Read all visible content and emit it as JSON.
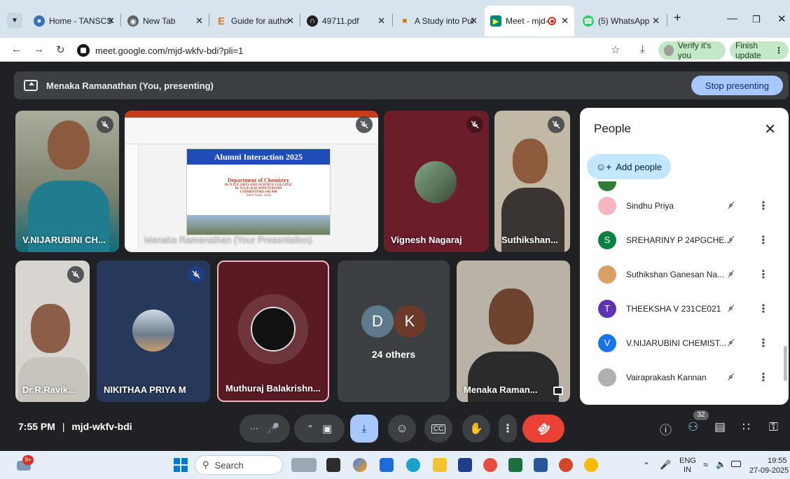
{
  "browser": {
    "tabs": [
      {
        "label": "Home - TANSCS",
        "icon": "tanscs-icon"
      },
      {
        "label": "New Tab",
        "icon": "chrome-icon"
      },
      {
        "label": "Guide for autho",
        "icon": "elsevier-icon"
      },
      {
        "label": "49711.pdf",
        "icon": "pdf-icon"
      },
      {
        "label": "A Study into Pul",
        "icon": "lock-icon"
      },
      {
        "label": "Meet - mjd-",
        "icon": "meet-icon"
      },
      {
        "label": "(5) WhatsApp",
        "icon": "whatsapp-icon"
      }
    ],
    "new_tab": "+",
    "url": "meet.google.com/mjd-wkfv-bdi?pli=1",
    "verify_label": "Verify it's you",
    "finish_label": "Finish update"
  },
  "meet": {
    "presenting_label": "Menaka Ramanathan (You, presenting)",
    "stop_label": "Stop presenting",
    "tiles": {
      "t1": "V.NIJARUBINI CH...",
      "t2": "Menaka Ramanathan (Your Presentation)",
      "t3": "Vignesh Nagaraj",
      "t4": "Suthikshan...",
      "t5": "Dr.R.Ravik...",
      "t6": "NIKITHAA PRIYA M",
      "t7": "Muthuraj Balakrishn...",
      "t8": "24 others",
      "t9": "Menaka Raman..."
    },
    "others_initials": [
      "D",
      "K"
    ],
    "slide": {
      "title": "Alumni Interaction 2025",
      "dept": "Department of Chemistry",
      "line1": "Dr N.G.P. ARTS AND SCIENCE COLLEGE",
      "line2": "Dr N.G.P. KALAPATTI ROAD",
      "line3": "COIMBATORE-641 048",
      "line4": "Tamil Nadu, India"
    },
    "time": "7:55 PM",
    "separator": "|",
    "meeting_code": "mjd-wkfv-bdi",
    "participant_count": "32"
  },
  "people_panel": {
    "title": "People",
    "add_label": "Add people",
    "rows": [
      {
        "name": "Sindhu Priya",
        "avatar": "photo",
        "color": "#f4b6c2"
      },
      {
        "name": "SREHARINY P 24PGCHE...",
        "avatar": "S",
        "color": "#0b8043"
      },
      {
        "name": "Suthikshan Ganesan Na...",
        "avatar": "photo",
        "color": "#d9a066"
      },
      {
        "name": "THEEKSHA V 231CE021",
        "avatar": "T",
        "color": "#5e35b1"
      },
      {
        "name": "V.NIJARUBINI CHEMIST...",
        "avatar": "V",
        "color": "#1a73e8"
      },
      {
        "name": "Vairaprakash Kannan",
        "avatar": "photo",
        "color": "#b0b0b0"
      }
    ]
  },
  "taskbar": {
    "notif_badge": "9+",
    "search_label": "Search",
    "lang1": "ENG",
    "lang2": "IN",
    "clock": "19:55",
    "date": "27-09-2025"
  }
}
